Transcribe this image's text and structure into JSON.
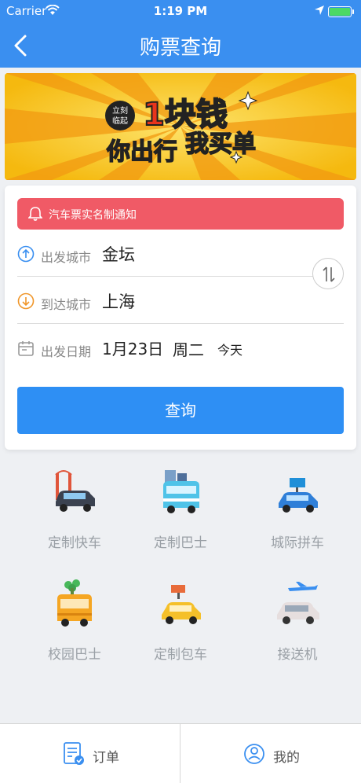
{
  "status_bar": {
    "carrier": "Carrier",
    "time": "1:19 PM"
  },
  "nav": {
    "title": "购票查询"
  },
  "banner": {
    "line1a": "立刻",
    "line1b": "临起",
    "big": "1块钱",
    "line2a": "你出行",
    "line2b": "我买单"
  },
  "form": {
    "notice": "汽车票实名制通知",
    "departure_label": "出发城市",
    "departure_value": "金坛",
    "arrival_label": "到达城市",
    "arrival_value": "上海",
    "date_label": "出发日期",
    "date_value": "1月23日",
    "weekday": "周二",
    "today": "今天",
    "query_button": "查询"
  },
  "services": [
    {
      "name": "定制快车",
      "icon": "custom-express-car-icon"
    },
    {
      "name": "定制巴士",
      "icon": "custom-bus-icon"
    },
    {
      "name": "城际拼车",
      "icon": "intercity-carpool-icon"
    },
    {
      "name": "校园巴士",
      "icon": "campus-bus-icon"
    },
    {
      "name": "定制包车",
      "icon": "charter-car-icon"
    },
    {
      "name": "接送机",
      "icon": "airport-transfer-icon"
    }
  ],
  "tabbar": {
    "orders": "订单",
    "mine": "我的"
  },
  "colors": {
    "primary": "#3a8ff0",
    "button": "#2e8ff4",
    "notice": "#f05a66",
    "banner_bg": "#f6c21c"
  }
}
